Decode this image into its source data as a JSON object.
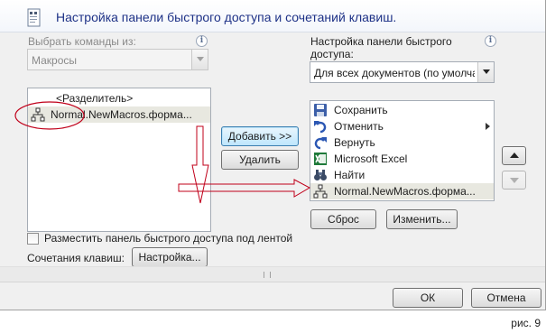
{
  "header": {
    "title": "Настройка панели быстрого доступа и сочетаний клавиш."
  },
  "left": {
    "choose_label": "Выбрать команды из:",
    "choose_value": "Макросы",
    "items": [
      {
        "label": "<Разделитель>",
        "icon": ""
      },
      {
        "label": "Normal.NewMacros.форма...",
        "icon": "macro-icon"
      }
    ]
  },
  "right": {
    "customize_label_line1": "Настройка панели быстрого",
    "customize_label_line2": "доступа:",
    "customize_value": "Для всех документов (по умолча",
    "items": [
      {
        "label": "Сохранить",
        "icon": "save-icon"
      },
      {
        "label": "Отменить",
        "icon": "undo-icon"
      },
      {
        "label": "Вернуть",
        "icon": "redo-icon"
      },
      {
        "label": "Microsoft Excel",
        "icon": "excel-icon"
      },
      {
        "label": "Найти",
        "icon": "binoculars-icon"
      },
      {
        "label": "Normal.NewMacros.форма...",
        "icon": "macro-icon"
      }
    ],
    "reset_label": "Сброс",
    "modify_label": "Изменить..."
  },
  "buttons": {
    "add": "Добавить >>",
    "remove": "Удалить",
    "ok": "ОК",
    "cancel": "Отмена",
    "customize": "Настройка..."
  },
  "checkbox": {
    "label": "Разместить панель быстрого доступа под лентой",
    "checked": false
  },
  "shortcuts_label": "Сочетания клавиш:",
  "caption": "рис. 9",
  "colors": {
    "title": "#1e3287",
    "annotation": "#c0001a"
  }
}
